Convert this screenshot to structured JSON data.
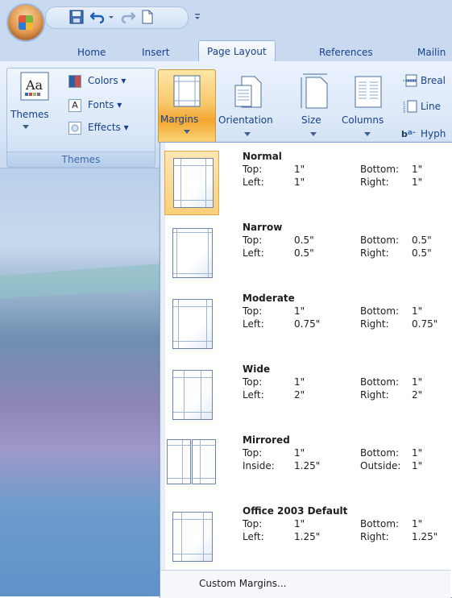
{
  "tabs": [
    {
      "label": "Home"
    },
    {
      "label": "Insert"
    },
    {
      "label": "Page Layout"
    },
    {
      "label": "References"
    },
    {
      "label": "Mailin"
    }
  ],
  "themes_group": {
    "themes_label": "Themes",
    "colors_label": "Colors",
    "fonts_label": "Fonts",
    "effects_label": "Effects",
    "group_title": "Themes"
  },
  "page_setup": {
    "margins_label": "Margins",
    "orientation_label": "Orientation",
    "size_label": "Size",
    "columns_label": "Columns",
    "breaks_label": "Breal",
    "line_numbers_label": "Line",
    "hyphenation_label": "Hyph"
  },
  "margins_menu": {
    "items": [
      {
        "name": "Normal",
        "k1": "Top:",
        "v1": "1\"",
        "k2": "Bottom:",
        "v2": "1\"",
        "k3": "Left:",
        "v3": "1\"",
        "k4": "Right:",
        "v4": "1\""
      },
      {
        "name": "Narrow",
        "k1": "Top:",
        "v1": "0.5\"",
        "k2": "Bottom:",
        "v2": "0.5\"",
        "k3": "Left:",
        "v3": "0.5\"",
        "k4": "Right:",
        "v4": "0.5\""
      },
      {
        "name": "Moderate",
        "k1": "Top:",
        "v1": "1\"",
        "k2": "Bottom:",
        "v2": "1\"",
        "k3": "Left:",
        "v3": "0.75\"",
        "k4": "Right:",
        "v4": "0.75\""
      },
      {
        "name": "Wide",
        "k1": "Top:",
        "v1": "1\"",
        "k2": "Bottom:",
        "v2": "1\"",
        "k3": "Left:",
        "v3": "2\"",
        "k4": "Right:",
        "v4": "2\""
      },
      {
        "name": "Mirrored",
        "k1": "Top:",
        "v1": "1\"",
        "k2": "Bottom:",
        "v2": "1\"",
        "k3": "Inside:",
        "v3": "1.25\"",
        "k4": "Outside:",
        "v4": "1\""
      },
      {
        "name": "Office 2003 Default",
        "k1": "Top:",
        "v1": "1\"",
        "k2": "Bottom:",
        "v2": "1\"",
        "k3": "Left:",
        "v3": "1.25\"",
        "k4": "Right:",
        "v4": "1.25\""
      }
    ],
    "custom_label": "Custom Margins..."
  },
  "colors": {
    "accent": "#f4a531",
    "ribbon": "#dce8f8",
    "tab_text": "#15428b"
  }
}
